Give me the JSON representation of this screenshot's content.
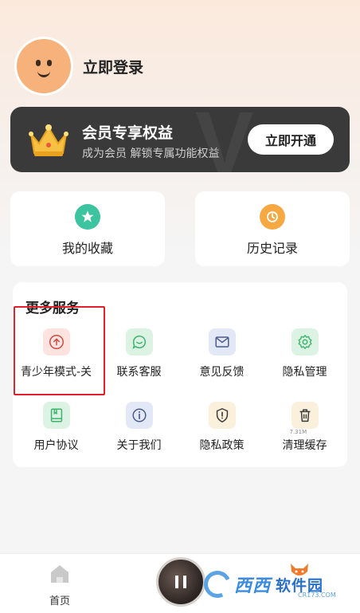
{
  "profile": {
    "login_label": "立即登录",
    "avatar_icon": "avatar-face-icon"
  },
  "vip": {
    "title": "会员专享权益",
    "subtitle": "成为会员 解锁专属功能权益",
    "button_label": "立即开通",
    "watermark": "V",
    "icon": "crown-icon"
  },
  "quick_cards": [
    {
      "label": "我的收藏",
      "icon": "star-icon",
      "color": "#3cc3a0"
    },
    {
      "label": "历史记录",
      "icon": "clock-icon",
      "color": "#f6a842"
    }
  ],
  "services": {
    "title": "更多服务",
    "items": [
      {
        "label": "青少年模式-关",
        "icon": "teen-mode-icon",
        "bg": "#fde3e0",
        "color": "#c94a3f"
      },
      {
        "label": "联系客服",
        "icon": "customer-service-icon",
        "bg": "#dcf3e4",
        "color": "#3cb36b"
      },
      {
        "label": "意见反馈",
        "icon": "mail-icon",
        "bg": "#e3e8f6",
        "color": "#4a5a86"
      },
      {
        "label": "隐私管理",
        "icon": "gear-icon",
        "bg": "#dcf3e4",
        "color": "#3cb36b"
      },
      {
        "label": "用户协议",
        "icon": "book-icon",
        "bg": "#dcf3e4",
        "color": "#3cb36b"
      },
      {
        "label": "关于我们",
        "icon": "info-icon",
        "bg": "#e3e8f6",
        "color": "#4a5a86"
      },
      {
        "label": "隐私政策",
        "icon": "shield-icon",
        "bg": "#fbf0dc",
        "color": "#a0744a"
      },
      {
        "label": "清理缓存",
        "icon": "trash-icon",
        "bg": "#fbf0dc",
        "color": "#7a6a55",
        "badge": "7.31M"
      }
    ]
  },
  "bottom_nav": {
    "home_label": "首页",
    "home_icon": "home-icon",
    "player_icon": "pause-icon",
    "right_icon": "fox-icon"
  },
  "watermark": {
    "main": "西西",
    "sub": "软件园",
    "url": "CR173.COM"
  }
}
